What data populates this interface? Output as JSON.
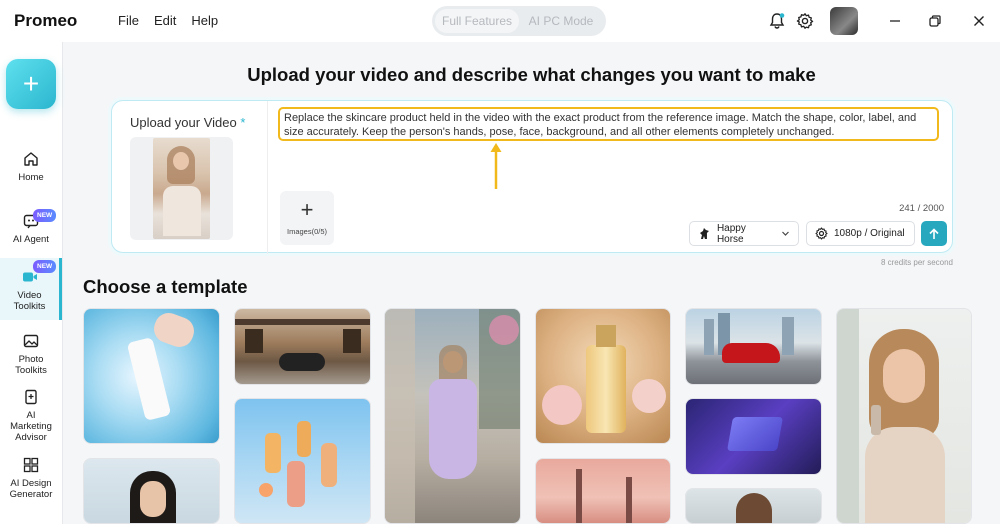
{
  "app": {
    "name": "Promeo"
  },
  "menu": {
    "file": "File",
    "edit": "Edit",
    "help": "Help"
  },
  "mode_switch": {
    "full": "Full Features",
    "ai_pc": "AI PC Mode"
  },
  "sidebar": {
    "add_symbol": "+",
    "items": [
      {
        "label": "Home",
        "icon": "home-icon"
      },
      {
        "label": "AI Agent",
        "icon": "ai-agent-icon",
        "badge": "NEW"
      },
      {
        "label": "Video Toolkits",
        "icon": "video-icon",
        "badge": "NEW",
        "active": true
      },
      {
        "label": "Photo Toolkits",
        "icon": "photo-icon"
      },
      {
        "label": "AI Marketing Advisor",
        "icon": "marketing-icon"
      },
      {
        "label": "AI Design Generator",
        "icon": "design-icon"
      }
    ]
  },
  "main": {
    "headline": "Upload your video and describe what changes you want to make",
    "upload_label": "Upload your Video",
    "required_mark": "*",
    "prompt": "Replace the skincare product held in the video with the exact product from the reference image. Match the shape, color, label, and size accurately. Keep the person's hands, pose, face, background, and all other elements completely unchanged.",
    "images_label": "Images(0/5)",
    "char_count": "241 / 2000",
    "model_chip": "Happy Horse",
    "quality_chip": "1080p / Original",
    "credits_note": "8 credits per second",
    "templates_title": "Choose a template"
  },
  "colors": {
    "accent": "#2bb6cf",
    "highlight": "#f2b91c",
    "send": "#28a8bf"
  }
}
